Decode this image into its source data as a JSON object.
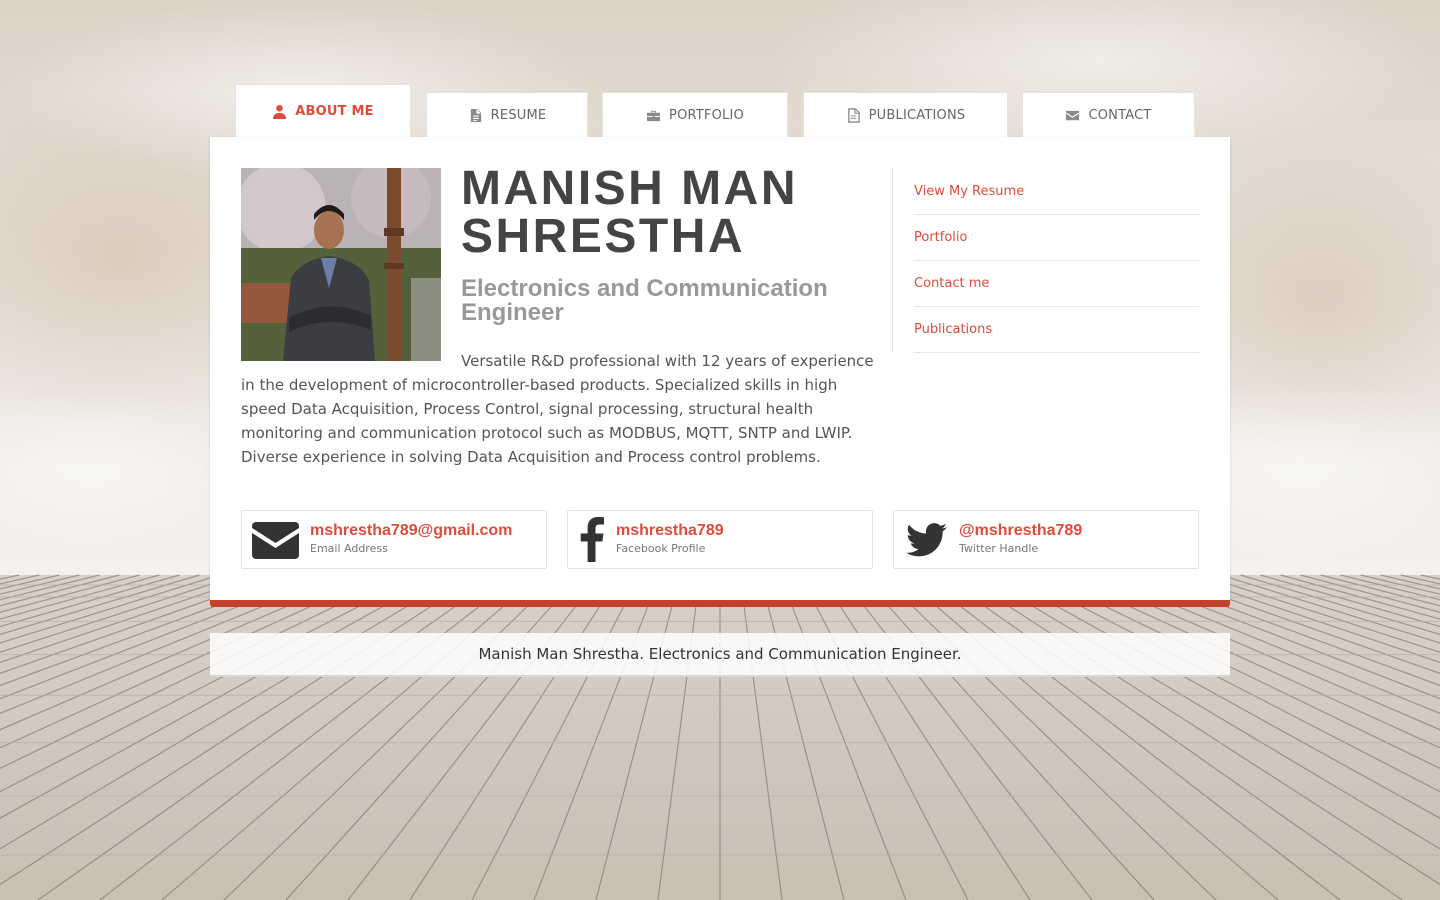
{
  "tabs": [
    {
      "label": "ABOUT ME",
      "icon": "user-icon",
      "active": true
    },
    {
      "label": "RESUME",
      "icon": "document-icon",
      "active": false
    },
    {
      "label": "PORTFOLIO",
      "icon": "briefcase-icon",
      "active": false
    },
    {
      "label": "PUBLICATIONS",
      "icon": "file-outline-icon",
      "active": false
    },
    {
      "label": "CONTACT",
      "icon": "envelope-icon",
      "active": false
    }
  ],
  "profile": {
    "name": "MANISH MAN SHRESTHA",
    "subtitle": "Electronics and Communication Engineer",
    "bio": "Versatile R&D professional with 12 years of experience in the development of microcontroller-based products. Specialized skills in high speed Data Acquisition, Process Control, signal processing, structural health monitoring and communication protocol such as MODBUS, MQTT, SNTP and LWIP. Diverse experience in solving Data Acquisition and Process control problems."
  },
  "sidebar": {
    "links": [
      "View My Resume",
      "Portfolio",
      "Contact me",
      "Publications"
    ]
  },
  "contacts": [
    {
      "value": "mshrestha789@gmail.com",
      "caption": "Email Address",
      "icon": "envelope-icon"
    },
    {
      "value": "mshrestha789",
      "caption": "Facebook Profile",
      "icon": "facebook-icon"
    },
    {
      "value": "@mshrestha789",
      "caption": "Twitter Handle",
      "icon": "twitter-icon"
    }
  ],
  "footer": {
    "text": "Manish Man Shrestha. Electronics and Communication Engineer."
  },
  "colors": {
    "accent": "#e04b3a",
    "accent_bar": "#c4412e",
    "text": "#444444"
  }
}
